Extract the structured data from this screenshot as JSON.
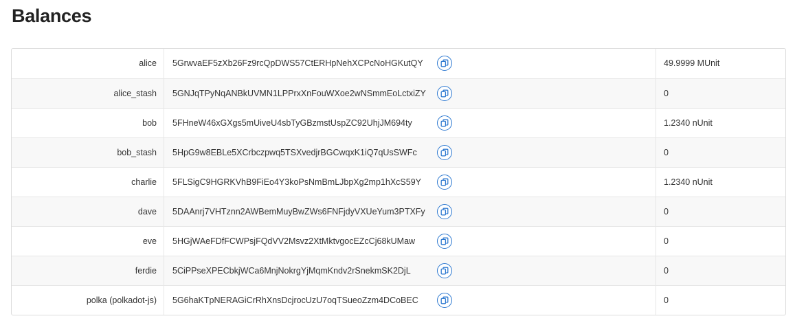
{
  "page": {
    "title": "Balances"
  },
  "accounts": [
    {
      "name": "alice",
      "address": "5GrwvaEF5zXb26Fz9rcQpDWS57CtERHpNehXCPcNoHGKutQY",
      "balance": "49.9999 MUnit"
    },
    {
      "name": "alice_stash",
      "address": "5GNJqTPyNqANBkUVMN1LPPrxXnFouWXoe2wNSmmEoLctxiZY",
      "balance": "0"
    },
    {
      "name": "bob",
      "address": "5FHneW46xGXgs5mUiveU4sbTyGBzmstUspZC92UhjJM694ty",
      "balance": "1.2340 nUnit"
    },
    {
      "name": "bob_stash",
      "address": "5HpG9w8EBLe5XCrbczpwq5TSXvedjrBGCwqxK1iQ7qUsSWFc",
      "balance": "0"
    },
    {
      "name": "charlie",
      "address": "5FLSigC9HGRKVhB9FiEo4Y3koPsNmBmLJbpXg2mp1hXcS59Y",
      "balance": "1.2340 nUnit"
    },
    {
      "name": "dave",
      "address": "5DAAnrj7VHTznn2AWBemMuyBwZWs6FNFjdyVXUeYum3PTXFy",
      "balance": "0"
    },
    {
      "name": "eve",
      "address": "5HGjWAeFDfFCWPsjFQdVV2Msvz2XtMktvgocEZcCj68kUMaw",
      "balance": "0"
    },
    {
      "name": "ferdie",
      "address": "5CiPPseXPECbkjWCa6MnjNokrgYjMqmKndv2rSnekmSK2DjL",
      "balance": "0"
    },
    {
      "name": "polka (polkadot-js)",
      "address": "5G6haKTpNERAGiCrRhXnsDcjrocUzU7oqTSueoZzm4DCoBEC",
      "balance": "0"
    }
  ],
  "icons": {
    "copy": "copy-icon"
  },
  "colors": {
    "accent": "#2f7ad1"
  }
}
